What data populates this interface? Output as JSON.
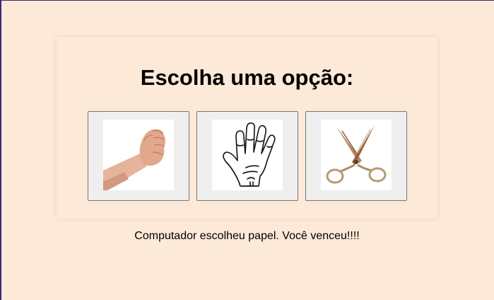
{
  "game": {
    "title": "Escolha uma opção:",
    "result": "Computador escolheu papel. Você venceu!!!!"
  },
  "choices": [
    {
      "name": "pedra",
      "icon": "rock-fist-icon"
    },
    {
      "name": "papel",
      "icon": "paper-hand-icon"
    },
    {
      "name": "tesoura",
      "icon": "scissors-icon"
    }
  ],
  "colors": {
    "background": "#fde9d7",
    "button_bg": "#efefef",
    "button_border": "#767676",
    "frame_border": "#3a2a70"
  }
}
